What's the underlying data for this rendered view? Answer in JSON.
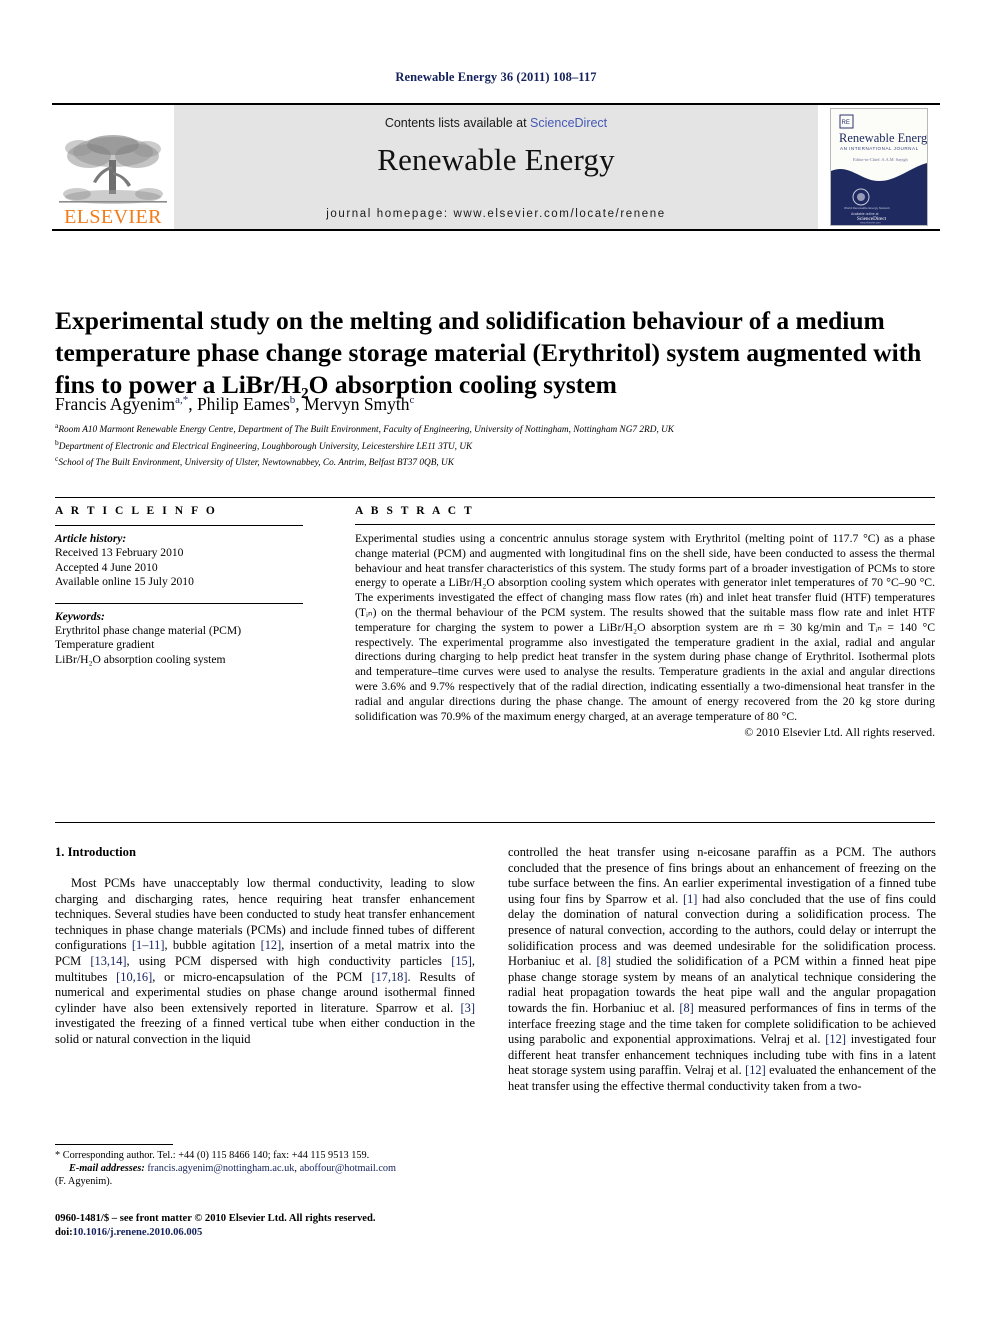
{
  "running_head": "Renewable Energy 36 (2011) 108–117",
  "masthead": {
    "publisher_name": "ELSEVIER",
    "contents_prefix": "Contents lists available at ",
    "sciencedirect": "ScienceDirect",
    "journal_title": "Renewable Energy",
    "homepage": "journal homepage: www.elsevier.com/locate/renene",
    "cover": {
      "title": "Renewable Energy",
      "subtitle": "AN INTERNATIONAL JOURNAL",
      "editor_line": "Editor-in-Chief: A.A.M. Sayigh",
      "society_line": "World Renewable Energy Network",
      "available_line": "Available online at",
      "platform": "ScienceDirect",
      "url": "www.elsevier.com"
    }
  },
  "article": {
    "title": "Experimental study on the melting and solidification behaviour of a medium temperature phase change storage material (Erythritol) system augmented with fins to power a LiBr/H₂O absorption cooling system",
    "authors": [
      {
        "name": "Francis Agyenim",
        "marks": "a,*"
      },
      {
        "name": "Philip Eames",
        "marks": "b"
      },
      {
        "name": "Mervyn Smyth",
        "marks": "c"
      }
    ],
    "affiliations": [
      {
        "mark": "a",
        "text": "Room A10 Marmont Renewable Energy Centre, Department of The Built Environment, Faculty of Engineering, University of Nottingham, Nottingham  NG7 2RD, UK"
      },
      {
        "mark": "b",
        "text": "Department of Electronic and Electrical Engineering, Loughborough University, Leicestershire LE11 3TU, UK"
      },
      {
        "mark": "c",
        "text": "School of The Built Environment, University of Ulster, Newtownabbey, Co. Antrim, Belfast BT37 0QB, UK"
      }
    ]
  },
  "article_info": {
    "heading": "A R T I C L E    I N F O",
    "history_label": "Article history:",
    "history": [
      "Received 13 February 2010",
      "Accepted 4 June 2010",
      "Available online 15 July 2010"
    ],
    "keywords_label": "Keywords:",
    "keywords": [
      "Erythritol phase change material (PCM)",
      "Temperature gradient",
      "LiBr/H₂O absorption cooling system"
    ]
  },
  "abstract": {
    "heading": "A B S T R A C T",
    "paragraphs": [
      "Experimental studies using a concentric annulus storage system with Erythritol (melting point of 117.7 °C) as a phase change material (PCM) and augmented with longitudinal fins on the shell side, have been conducted to assess the thermal behaviour and heat transfer characteristics of this system. The study forms part of a broader investigation of PCMs to store energy to operate a LiBr/H₂O absorption cooling system which operates with generator inlet temperatures of 70 °C–90 °C. The experiments investigated the effect of changing mass flow rates (ṁ) and inlet heat transfer fluid (HTF) temperatures (Tᵢₙ) on the thermal behaviour of the PCM system. The results showed that the suitable mass flow rate and inlet HTF temperature for charging the system to power a LiBr/H₂O absorption system are ṁ = 30 kg/min and Tᵢₙ = 140 °C respectively. The experimental programme also investigated the temperature gradient in the axial, radial and angular directions during charging to help predict heat transfer in the system during phase change of Erythritol. Isothermal plots and temperature–time curves were used to analyse the results. Temperature gradients in the axial and angular directions were 3.6% and 9.7% respectively that of the radial direction, indicating essentially a two-dimensional heat transfer in the radial and angular directions during the phase change. The amount of energy recovered from the 20 kg store during solidification was 70.9% of the maximum energy charged, at an average temperature of 80 °C."
    ],
    "copyright": "© 2010 Elsevier Ltd. All rights reserved."
  },
  "body": {
    "section_heading": "1. Introduction",
    "left_paragraph_html": "Most PCMs have unacceptably low thermal conductivity, leading to slow charging and discharging rates, hence requiring heat transfer enhancement techniques. Several studies have been conducted to study heat transfer enhancement techniques in phase change materials (PCMs) and include finned tubes of different configurations <span class=\"ref\">[1–11]</span>, bubble agitation <span class=\"ref\">[12]</span>, insertion of a metal matrix into the PCM <span class=\"ref\">[13,14]</span>, using PCM dispersed with high conductivity particles <span class=\"ref\">[15]</span>, multitubes <span class=\"ref\">[10,16]</span>, or micro-encapsulation of the PCM <span class=\"ref\">[17,18]</span>. Results of numerical and experimental studies on phase change around isothermal finned cylinder have also been extensively reported in literature. Sparrow et al. <span class=\"ref\">[3]</span> investigated the freezing of a finned vertical tube when either conduction in the solid or natural convection in the liquid",
    "right_paragraph_html": "controlled the heat transfer using n-eicosane paraffin as a PCM. The authors concluded that the presence of fins brings about an enhancement of freezing on the tube surface between the fins. An earlier experimental investigation of a finned tube using four fins by Sparrow et al. <span class=\"ref\">[1]</span> had also concluded that the use of fins could delay the domination of natural convection during a solidification process. The presence of natural convection, according to the authors, could delay or interrupt the solidification process and was deemed undesirable for the solidification process. Horbaniuc et al. <span class=\"ref\">[8]</span> studied the solidification of a PCM within a finned heat pipe phase change storage system by means of an analytical technique considering the radial heat propagation towards the heat pipe wall and the angular propagation towards the fin. Horbaniuc et al. <span class=\"ref\">[8]</span> measured performances of fins in terms of the interface freezing stage and the time taken for complete solidification to be achieved using parabolic and exponential approximations. Velraj et al. <span class=\"ref\">[12]</span> investigated four different heat transfer enhancement techniques including tube with fins in a latent heat storage system using paraffin. Velraj et al. <span class=\"ref\">[12]</span> evaluated the enhancement of the heat transfer using the effective thermal conductivity taken from a two-"
  },
  "footnotes": {
    "corresponding": "* Corresponding author. Tel.: +44 (0) 115 8466 140; fax: +44 115 9513 159.",
    "email_label": "E-mail addresses:",
    "email1": "francis.agyenim@nottingham.ac.uk",
    "email_sep": ", ",
    "email2": "aboffour@hotmail.com",
    "email_owner": "(F. Agyenim)."
  },
  "colophon": {
    "issn_line": "0960-1481/$ – see front matter © 2010 Elsevier Ltd. All rights reserved.",
    "doi_label": "doi:",
    "doi": "10.1016/j.renene.2010.06.005"
  },
  "colors": {
    "link_blue": "#14215c",
    "sciencedirect_blue": "#4459b4",
    "elsevier_orange": "#f07c1a",
    "masthead_grey": "#e4e4e4",
    "cover_navy": "#1f2a60"
  }
}
